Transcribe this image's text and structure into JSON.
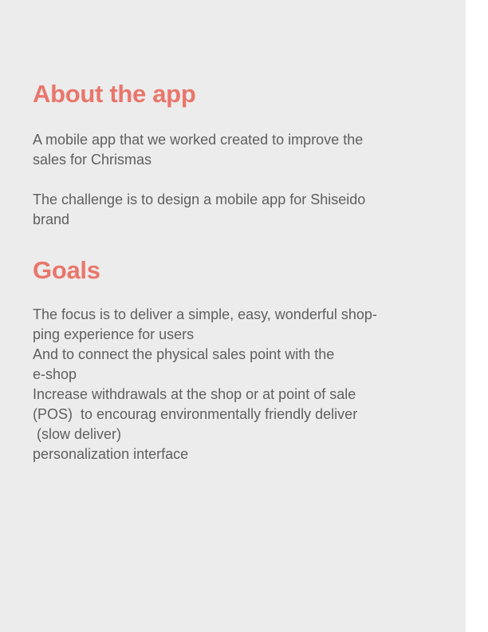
{
  "about": {
    "title": "About the app",
    "paragraph1": [
      "A mobile app that we worked created to improve the",
      "sales for Chrismas"
    ],
    "paragraph2": [
      "The challenge is to design a mobile app for Shiseido",
      "brand"
    ]
  },
  "goals": {
    "title": "Goals",
    "lines": [
      "The focus is to deliver a simple, easy, wonderful shop-",
      "ping experience for users",
      "And to connect the physical sales point with the",
      "e-shop",
      "Increase withdrawals at the shop or at point of sale",
      "(POS)  to encourag environmentally friendly deliver",
      " (slow deliver)",
      "personalization interface"
    ]
  },
  "colors": {
    "heading": "#e9766b",
    "body_text": "#5f5f5f",
    "panel_background": "#ececec"
  }
}
